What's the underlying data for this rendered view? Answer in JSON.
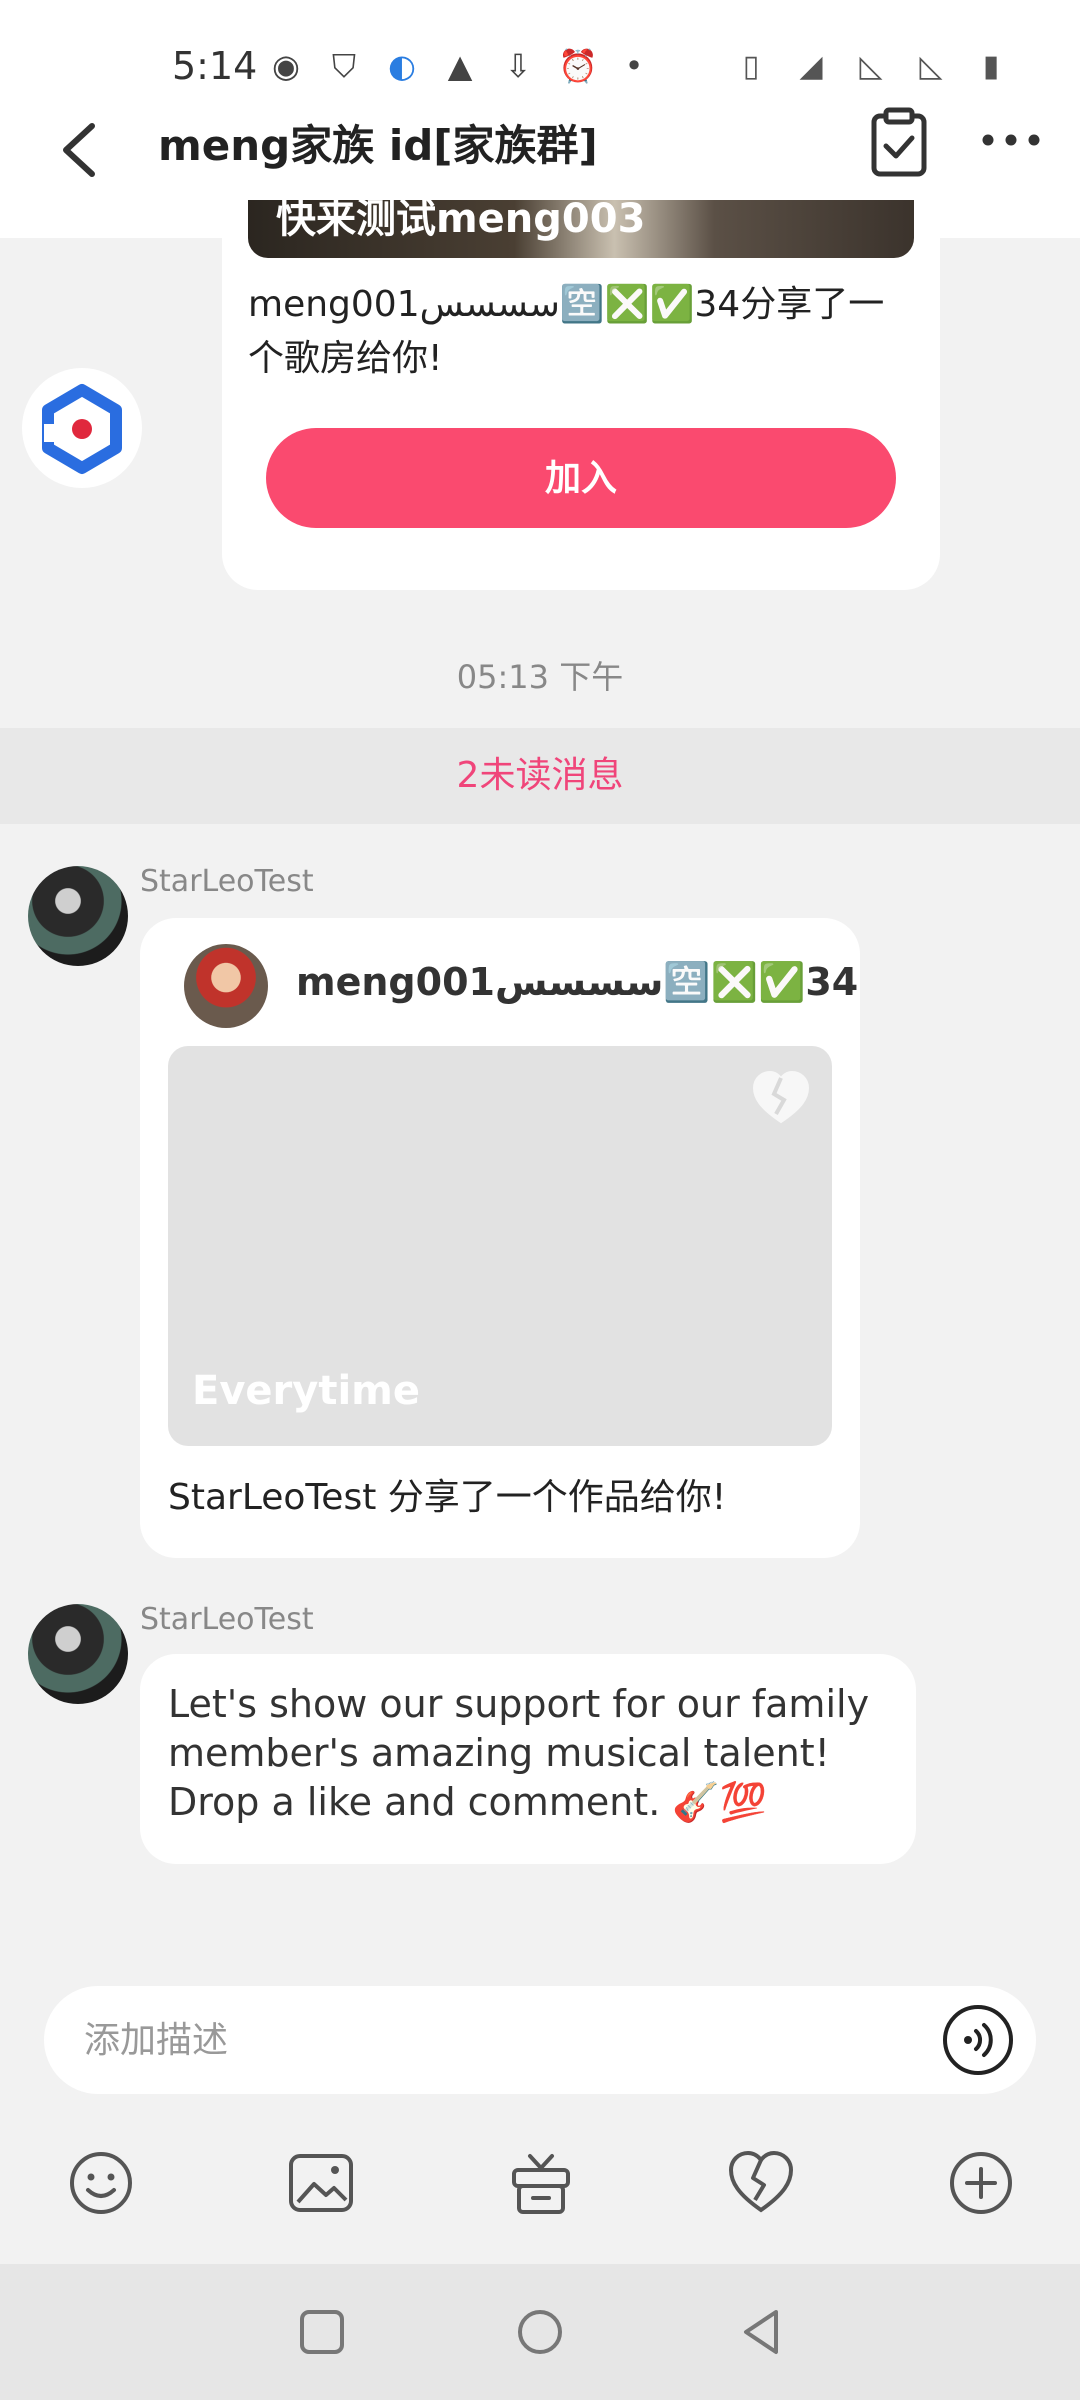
{
  "status_bar": {
    "time": "5:14"
  },
  "header": {
    "title": "meng家族 id[家族群]"
  },
  "room_share": {
    "banner_title": "快来测试meng003",
    "text": "meng001ﺳﺴﺴﺲ🈳❎✅34分享了一个歌房给你!",
    "join_label": "加入"
  },
  "timestamp": "05:13 下午",
  "unread_divider": "2未读消息",
  "messages": [
    {
      "sender": "StarLeoTest",
      "work_share": {
        "author": "meng001ﺳﺴﺴﺲ🈳❎✅34",
        "work_title": "Everytime",
        "description": "StarLeoTest 分享了一个作品给你!"
      }
    },
    {
      "sender": "StarLeoTest",
      "text": "Let's show our support for our family member's amazing musical talent! Drop a like and comment. 🎸💯"
    }
  ],
  "composer": {
    "placeholder": "添加描述"
  },
  "colors": {
    "accent": "#fa4a6f",
    "unread": "#f0457a",
    "background": "#f2f2f2",
    "card": "#ffffff"
  },
  "icons": {
    "back": "back-arrow-icon",
    "clipboard": "clipboard-check-icon",
    "more": "more-dots-icon",
    "voice": "voice-input-icon",
    "emoji": "emoji-icon",
    "image": "image-icon",
    "gift": "gift-icon",
    "heart": "broken-heart-icon",
    "plus": "plus-circle-icon"
  }
}
